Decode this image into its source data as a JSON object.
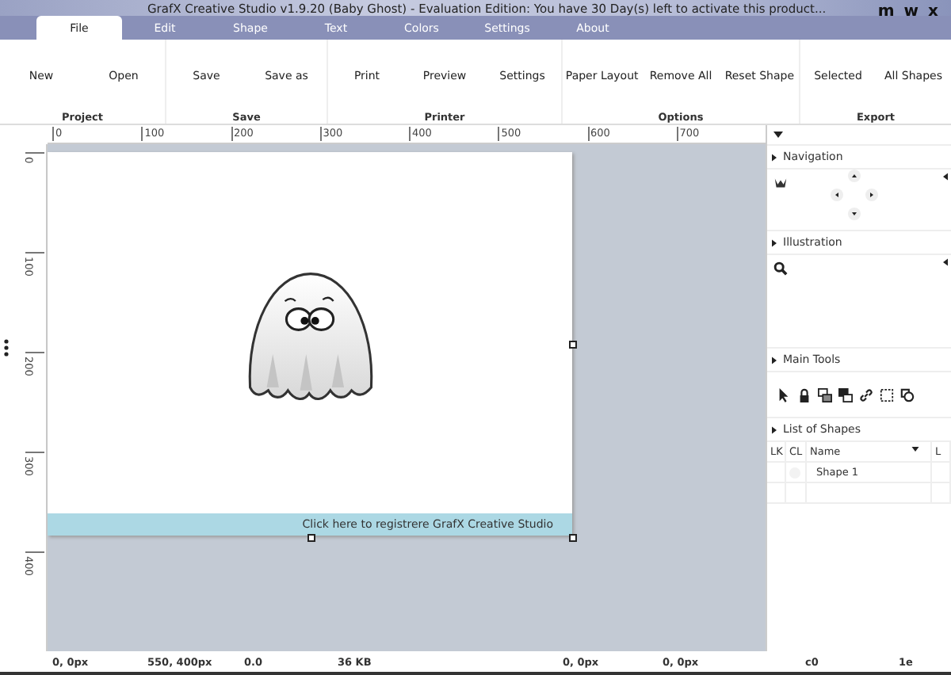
{
  "window": {
    "title": "GrafX Creative Studio v1.9.20 (Baby Ghost) - Evaluation Edition: You have 30 Day(s) left to activate this product...",
    "controls": [
      "m",
      "w",
      "x"
    ]
  },
  "tabs": [
    {
      "label": "File",
      "selected": true
    },
    {
      "label": "Edit",
      "selected": false
    },
    {
      "label": "Shape",
      "selected": false
    },
    {
      "label": "Text",
      "selected": false
    },
    {
      "label": "Colors",
      "selected": false
    },
    {
      "label": "Settings",
      "selected": false
    },
    {
      "label": "About",
      "selected": false
    }
  ],
  "ribbon": {
    "groups": [
      {
        "label": "Project",
        "buttons": [
          "New",
          "Open"
        ]
      },
      {
        "label": "Save",
        "buttons": [
          "Save",
          "Save as"
        ]
      },
      {
        "label": "Printer",
        "buttons": [
          "Print",
          "Preview",
          "Settings"
        ]
      },
      {
        "label": "Options",
        "buttons": [
          "Paper Layout",
          "Remove All",
          "Reset Shape"
        ]
      },
      {
        "label": "Export",
        "buttons": [
          "Selected",
          "All Shapes"
        ]
      }
    ]
  },
  "rulers": {
    "horizontal": [
      "0",
      "100",
      "200",
      "300",
      "400",
      "500",
      "600",
      "700"
    ],
    "vertical": [
      "0",
      "100",
      "200",
      "300",
      "400"
    ]
  },
  "canvas": {
    "banner": "Click here to registrere GrafX Creative Studio"
  },
  "panel": {
    "sections": [
      {
        "kind": "navigation",
        "title": "Navigation"
      },
      {
        "kind": "illustration",
        "title": "Illustration"
      },
      {
        "kind": "tools",
        "title": "Main Tools"
      },
      {
        "kind": "shapes",
        "title": "List of Shapes",
        "columns": [
          "LK",
          "CL",
          "Name",
          "L"
        ],
        "rows": [
          {
            "name": "Shape 1"
          }
        ]
      }
    ]
  },
  "status_bar": [
    "0, 0px",
    "550, 400px",
    "0.0",
    "36 KB",
    "0, 0px",
    "0, 0px",
    "c0",
    "1e"
  ]
}
